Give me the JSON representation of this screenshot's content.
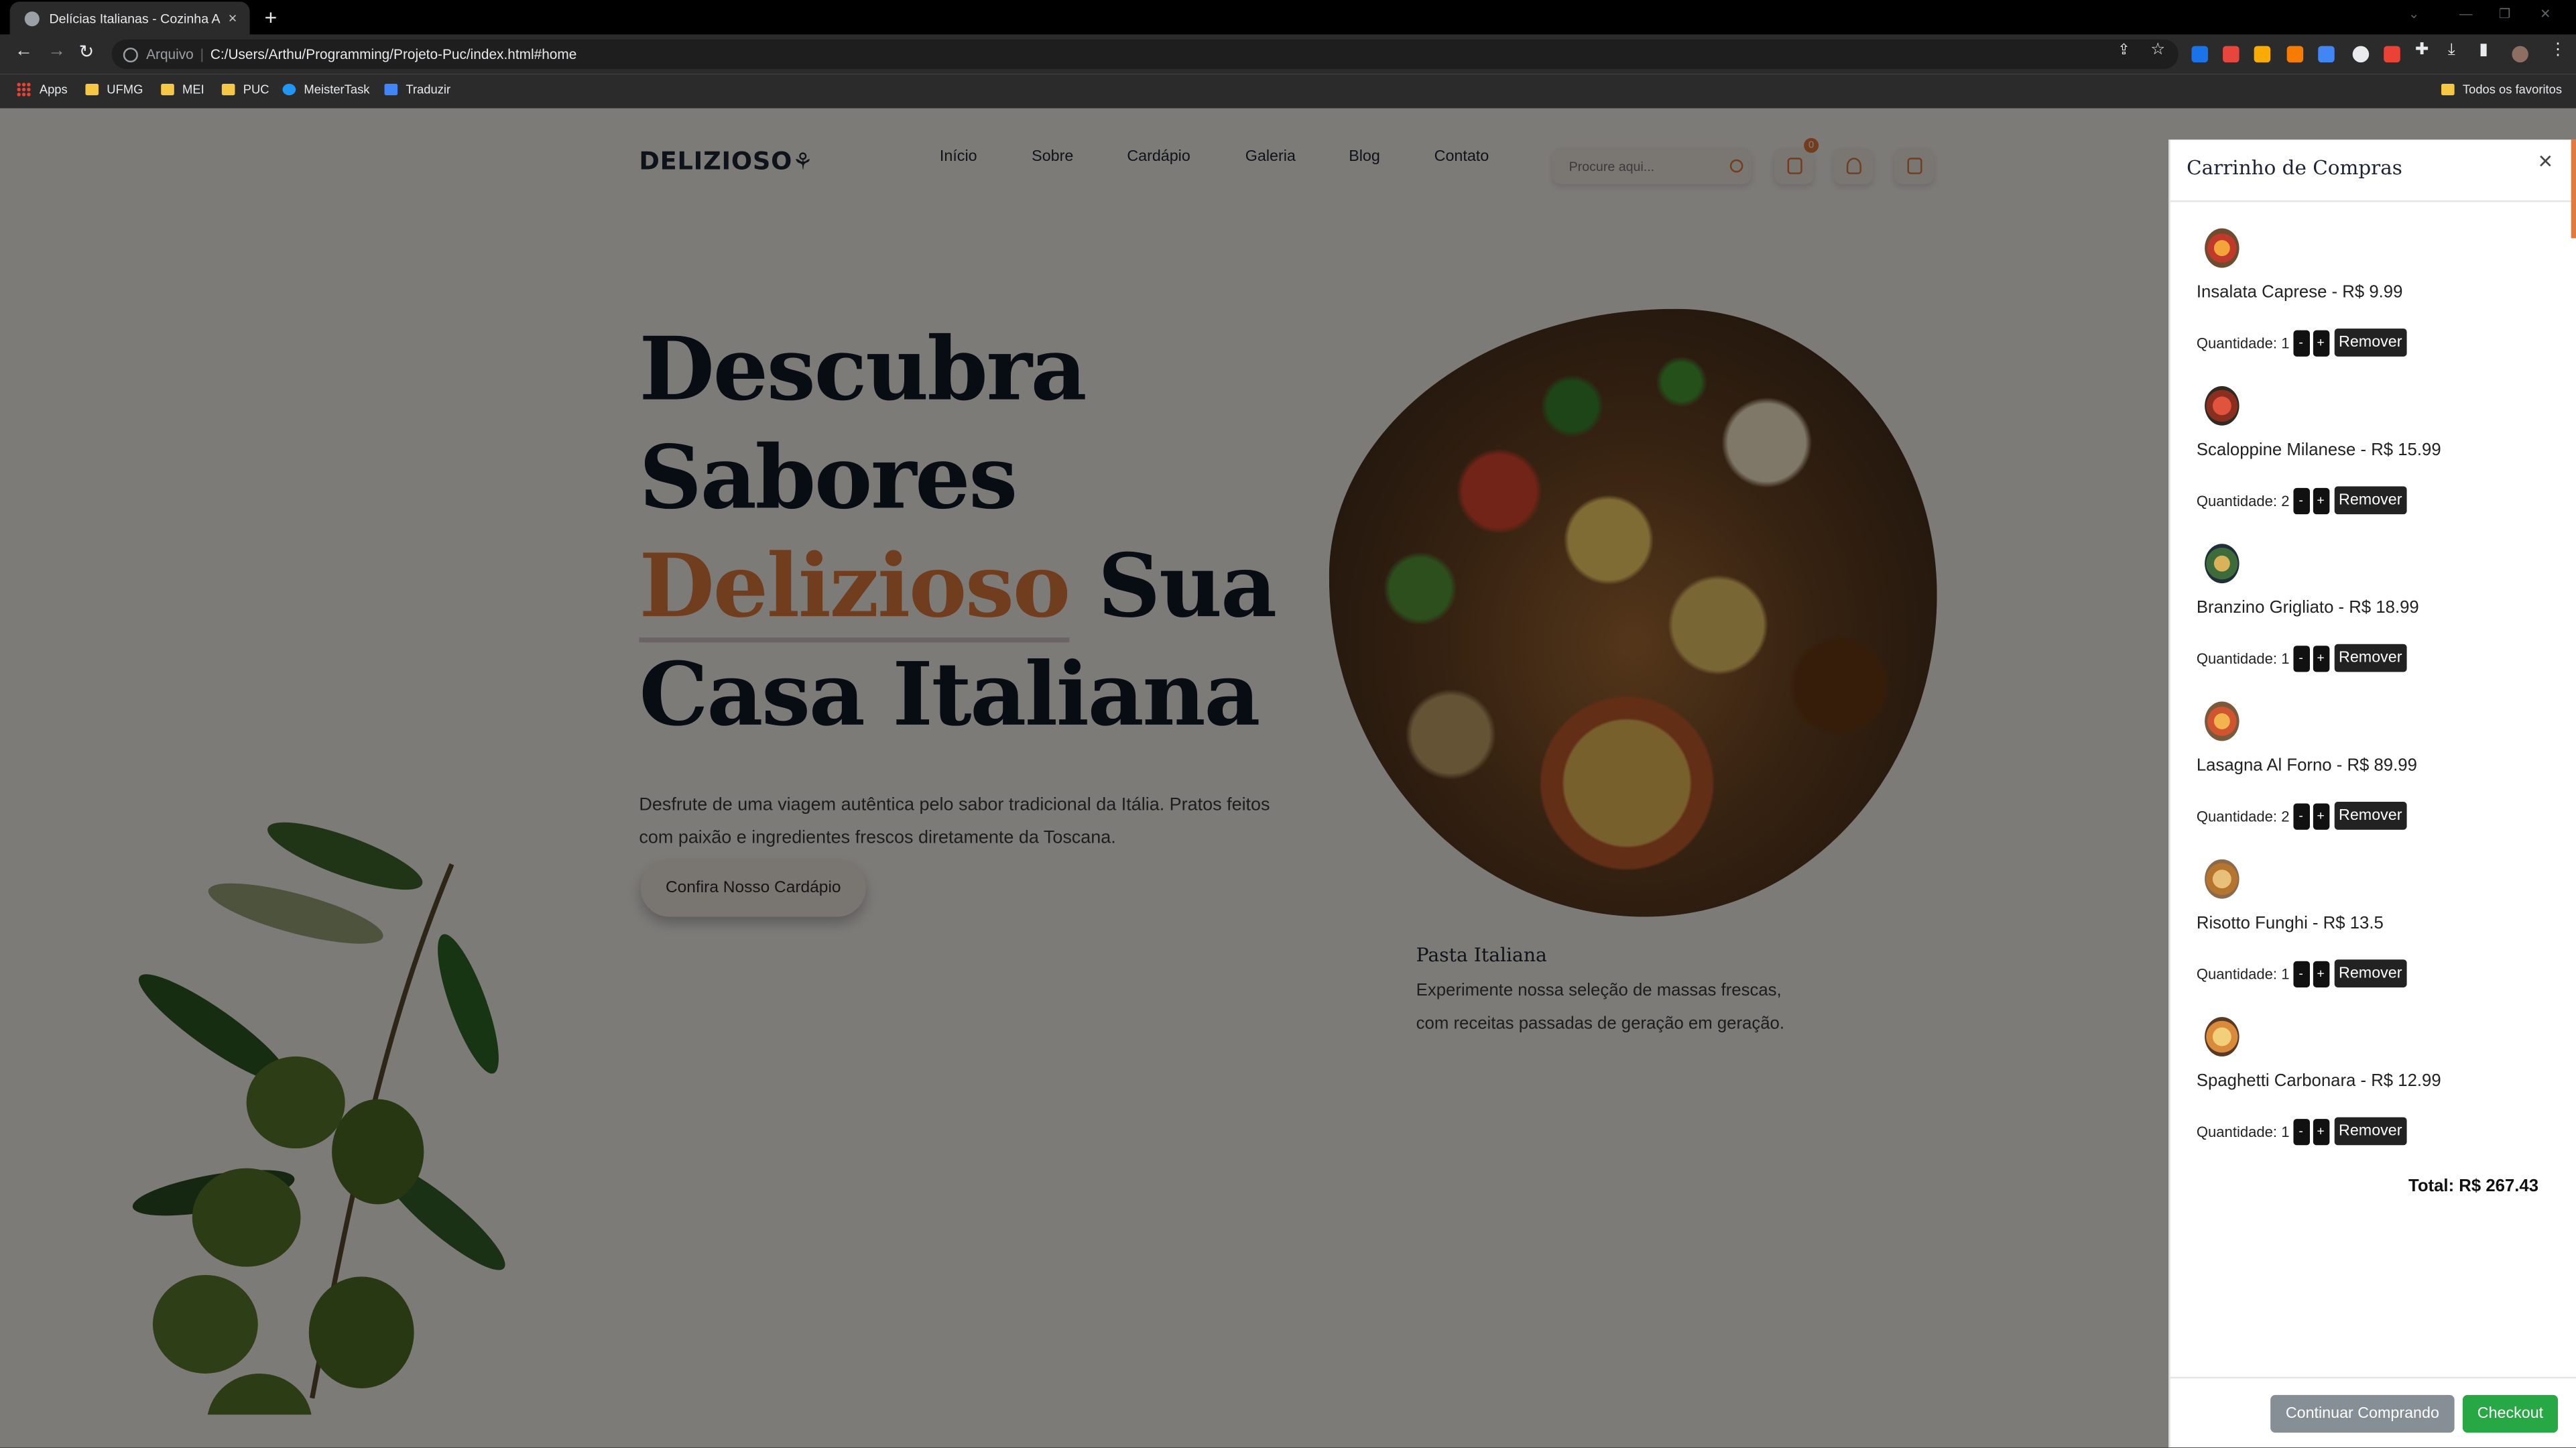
{
  "browser": {
    "tab_title": "Delícias Italianas - Cozinha Autê",
    "tab_close": "×",
    "new_tab": "+",
    "omnibox_prefix": "Arquivo",
    "omnibox_sep": "|",
    "url": "C:/Users/Arthu/Programming/Projeto-Puc/index.html#home",
    "bookmarks": [
      "Apps",
      "UFMG",
      "MEI",
      "PUC",
      "MeisterTask",
      "Traduzir"
    ],
    "all_bookmarks": "Todos os favoritos"
  },
  "site": {
    "logo": "DELIZIOSO",
    "nav": [
      "Início",
      "Sobre",
      "Cardápio",
      "Galeria",
      "Blog",
      "Contato"
    ],
    "search_placeholder": "Procure aqui...",
    "cart_count": "0",
    "hero": {
      "line1": "Descubra",
      "line2": "Sabores",
      "accent": "Delizioso",
      "line3_rest": " Sua",
      "line4": "Casa Italiana",
      "lead": "Desfrute de uma viagem autêntica pelo sabor tradicional da Itália. Pratos feitos com paixão e ingredientes frescos diretamente da Toscana.",
      "cta": "Confira Nosso Cardápio"
    },
    "feature": {
      "title": "Pasta Italiana",
      "text": "Experimente nossa seleção de massas frescas, com receitas passadas de geração em geração."
    }
  },
  "cart": {
    "title": "Carrinho de Compras",
    "close": "×",
    "qty_label": "Quantidade:",
    "minus": "-",
    "plus": "+",
    "remove": "Remover",
    "items": [
      {
        "name": "Insalata Caprese - R$ 9.99",
        "qty": "1"
      },
      {
        "name": "Scaloppine Milanese - R$ 15.99",
        "qty": "2"
      },
      {
        "name": "Branzino Grigliato - R$ 18.99",
        "qty": "1"
      },
      {
        "name": "Lasagna Al Forno - R$ 89.99",
        "qty": "2"
      },
      {
        "name": "Risotto Funghi - R$ 13.5",
        "qty": "1"
      },
      {
        "name": "Spaghetti Carbonara - R$ 12.99",
        "qty": "1"
      }
    ],
    "total": "Total: R$ 267.43",
    "continue": "Continuar Comprando",
    "checkout": "Checkout"
  },
  "colors": {
    "accent": "#e07a3f",
    "checkout": "#28a745",
    "continue": "#868e96"
  }
}
